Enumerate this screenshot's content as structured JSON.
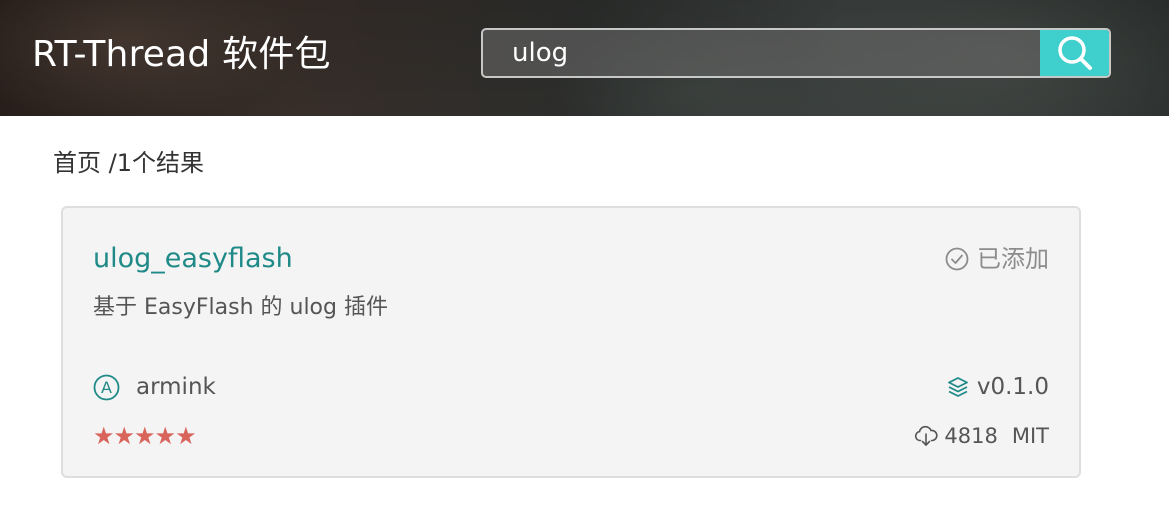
{
  "header": {
    "title": "RT-Thread 软件包"
  },
  "search": {
    "value": "ulog",
    "icon": "search-icon",
    "button_color": "#3fcfcc"
  },
  "breadcrumb": {
    "text": "首页 /1个结果"
  },
  "result": {
    "name": "ulog_easyflash",
    "status": "已添加",
    "status_icon": "check-circle-icon",
    "description": "基于 EasyFlash 的 ulog 插件",
    "author": "armink",
    "author_icon": "author-initial-icon",
    "author_initial": "A",
    "version": "v0.1.0",
    "version_icon": "layers-icon",
    "rating": 5,
    "stars": "★★★★★",
    "downloads": "4818",
    "downloads_icon": "cloud-download-icon",
    "license": "MIT"
  },
  "colors": {
    "accent": "#1f8a88",
    "star": "#d9645c"
  }
}
